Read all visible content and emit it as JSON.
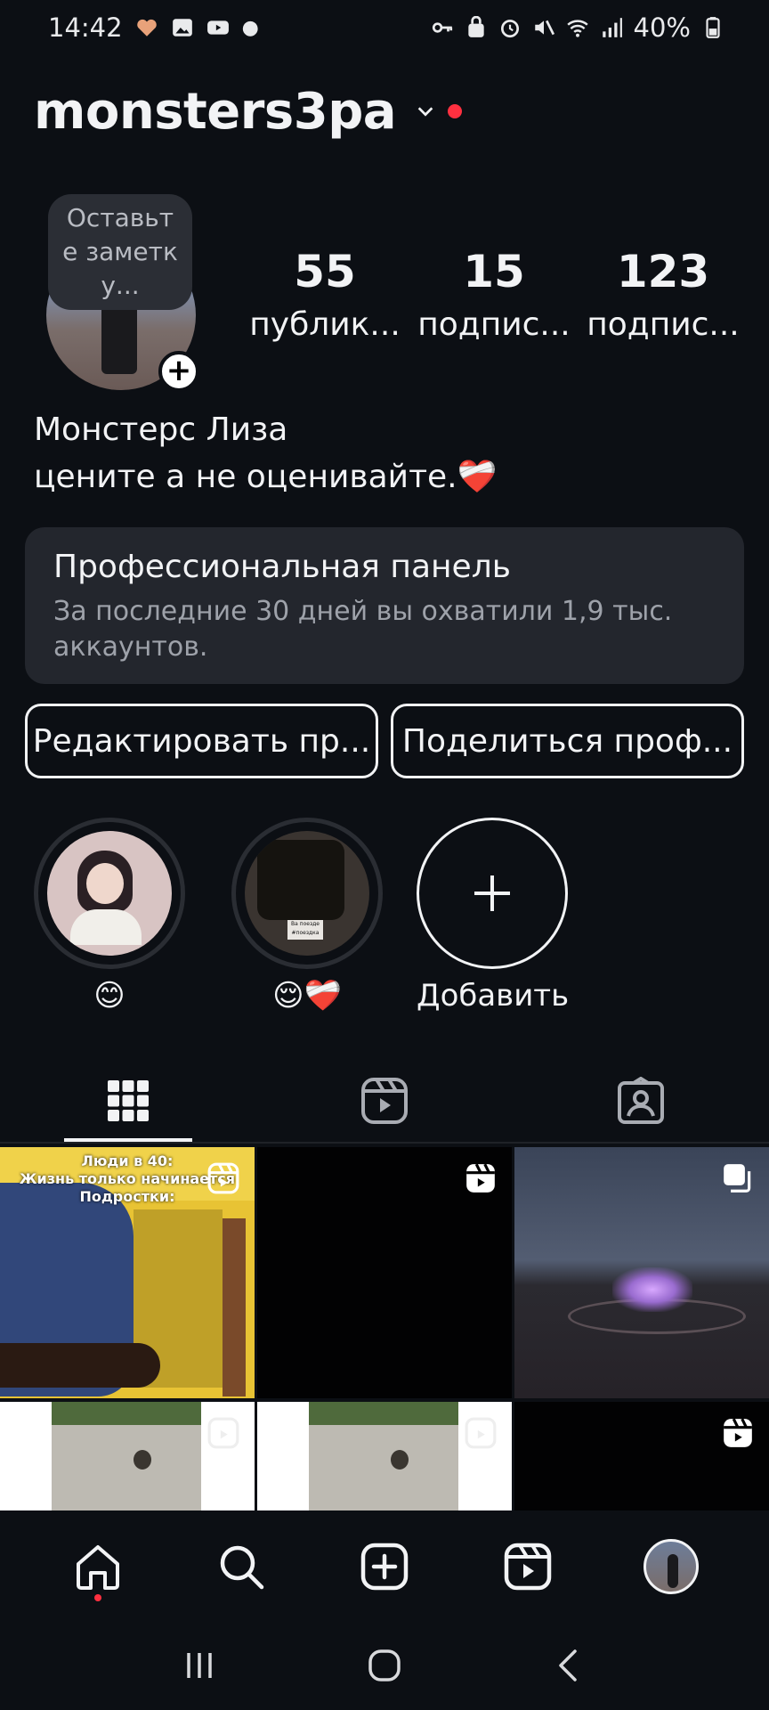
{
  "status_bar": {
    "time": "14:42",
    "battery": "40%"
  },
  "profile": {
    "username": "monsters3pa",
    "note_placeholder": "Оставьте заметку...",
    "note_lines": [
      "Оставьт",
      "е заметк",
      "у..."
    ],
    "stats": [
      {
        "value": "55",
        "label": "публик..."
      },
      {
        "value": "15",
        "label": "подпис..."
      },
      {
        "value": "123",
        "label": "подпис..."
      }
    ],
    "full_name": "Монстерс Лиза",
    "bio": "цените а не оценивайте.❤️‍🩹"
  },
  "pro_panel": {
    "title": "Профессиональная панель",
    "subtitle": "За последние 30 дней вы охватили 1,9 тыс. аккаунтов."
  },
  "buttons": {
    "edit": "Редактировать пр...",
    "share": "Поделиться проф..."
  },
  "highlights": [
    {
      "caption": "😊"
    },
    {
      "caption": "😌❤️‍🩹",
      "thumb_text": "Ва поезде #поездка"
    },
    {
      "caption": "Добавить"
    }
  ],
  "tabs": [
    "grid-icon",
    "reels-icon",
    "tagged-icon"
  ],
  "grid": {
    "post1_text": [
      "Люди в 40:",
      "Жизнь только начинается",
      "Подростки:"
    ]
  },
  "bottom_nav": [
    "home-icon",
    "search-icon",
    "create-icon",
    "reels-icon",
    "profile-avatar"
  ],
  "colors": {
    "background": "#0c0f14",
    "panel": "#23262d",
    "notification": "#ff3040"
  }
}
